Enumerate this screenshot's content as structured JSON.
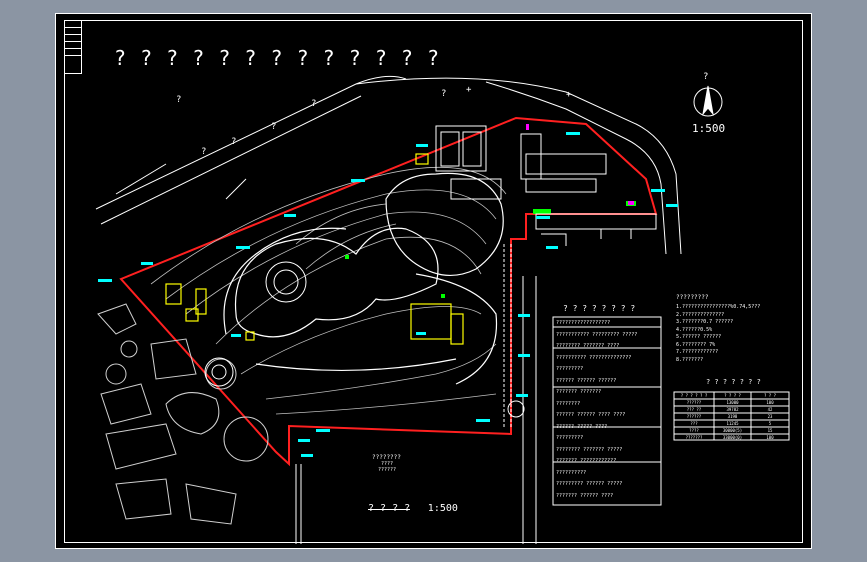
{
  "drawing": {
    "header_title": "? ? ? ? ? ? ? ? ? ? ? ? ?",
    "scale_north": "1:500",
    "north_arrow_letter": "?",
    "bottom_title": "? ? ? ?",
    "bottom_scale": "1:500",
    "center_caption": "????????",
    "center_caption_sub": "????",
    "center_caption_sub2": "??????"
  },
  "legend_left": {
    "title": "? ? ? ? ? ? ? ?",
    "rows": [
      "??????????????????",
      "??????????? ????????? ?????",
      "???????? ??????? ????",
      "?????????? ??????????????",
      "?????????",
      "?????? ?????? ??????",
      "??????? ???????",
      "????????",
      "?????? ?????? ???? ????",
      "?????? ????? ????",
      "?????????",
      "???????? ??????? ?????",
      "??????? ????????????",
      "??????????",
      "????????? ?????? ?????",
      "??????? ?????? ????"
    ]
  },
  "notes_right": {
    "title": "?????????",
    "lines": [
      "1.????????????????%0.74,5???",
      "2.??????????????",
      "3.???????0.7 ??????",
      "4.??????0.5%",
      "5.?????? ??????",
      "6.???????? 7%",
      "7.????????????",
      "8.???????"
    ]
  },
  "table_right": {
    "title": "? ? ? ? ? ? ?",
    "headers": [
      "? ? ? ? ? ?",
      "? ? ? ?",
      "? ? ?"
    ],
    "rows": [
      [
        "??????",
        "13000",
        "100"
      ],
      [
        "??? ??",
        "39782",
        "42"
      ],
      [
        "??????",
        "3198",
        "23"
      ],
      [
        "???",
        "11245",
        "5"
      ],
      [
        "????",
        "30000(5)",
        "15"
      ],
      [
        "???????",
        "33000(0)",
        "100"
      ]
    ]
  },
  "colors": {
    "boundary": "#ff2020",
    "tick_labels": "#00ffff",
    "landscape_building": "#ffff00",
    "lawn": "#00ff00",
    "highlight": "#ff00ff"
  }
}
